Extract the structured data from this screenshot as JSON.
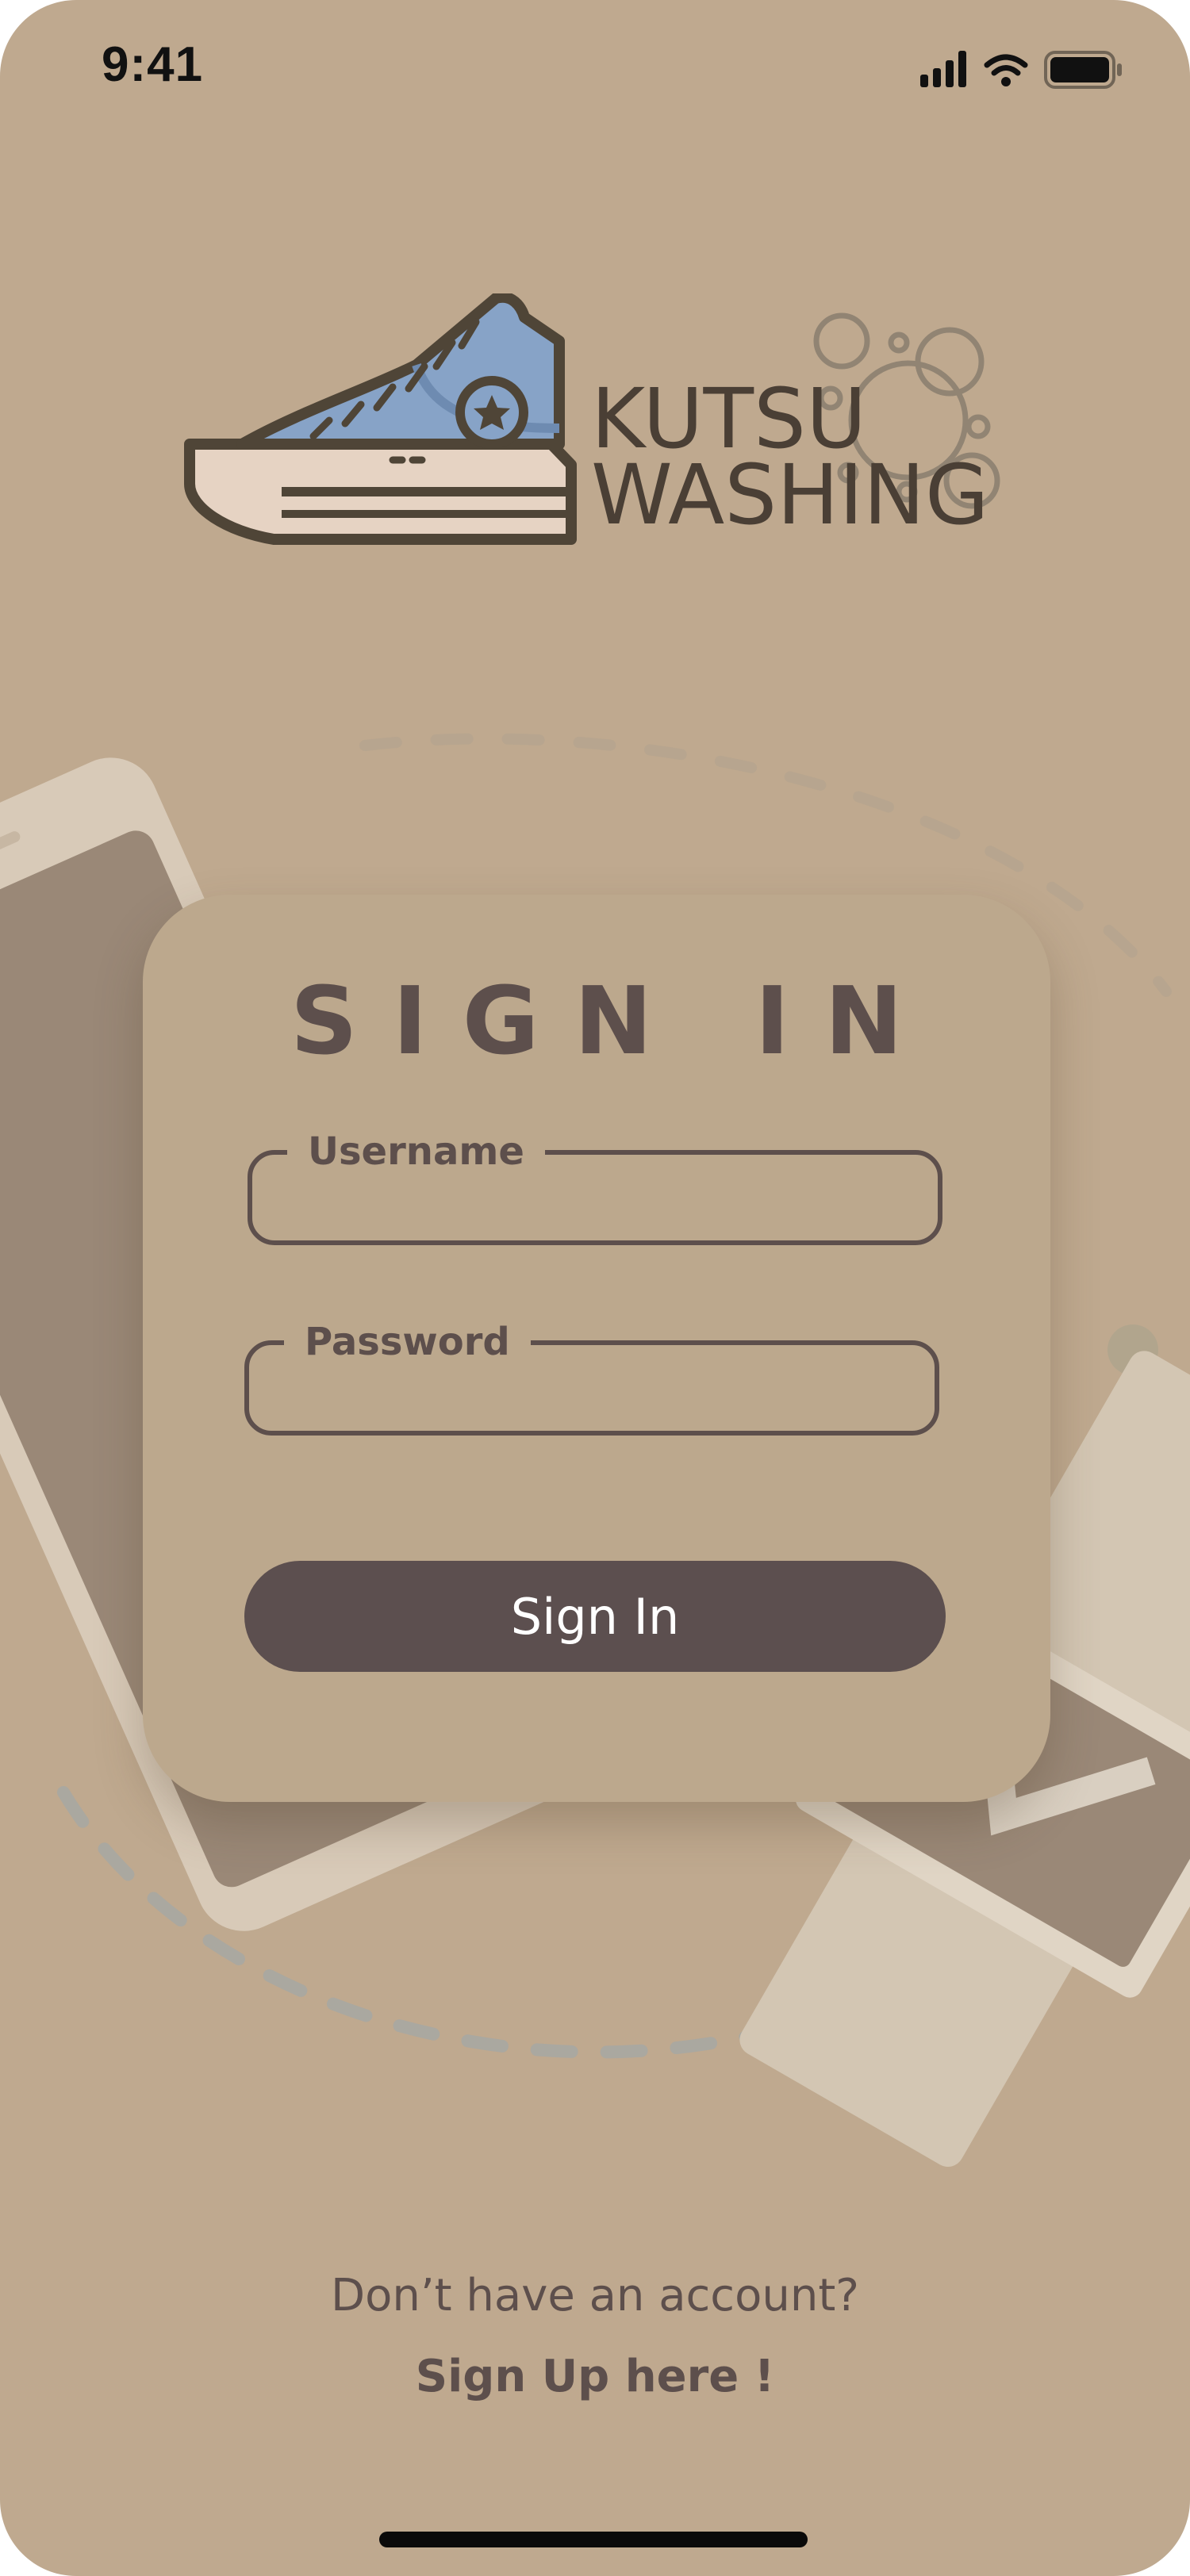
{
  "status_bar": {
    "time": "9:41"
  },
  "logo": {
    "line1": "KUTSU",
    "line2": "WASHING"
  },
  "sign_in": {
    "title": "SIGN IN",
    "username_label": "Username",
    "username_value": "",
    "password_label": "Password",
    "password_value": "",
    "button_label": "Sign In"
  },
  "footer": {
    "prompt": "Don’t have an account?",
    "signup_link": "Sign Up here !"
  },
  "colors": {
    "background": "#bfa98f",
    "card": "#bca88d",
    "text_dark": "#5d4f4c",
    "button": "#5c4f4f",
    "shoe_blue": "#87a3c7"
  },
  "icons": [
    "cellular-signal-icon",
    "wifi-icon",
    "battery-icon",
    "sneaker-icon",
    "bubbles-icon"
  ]
}
